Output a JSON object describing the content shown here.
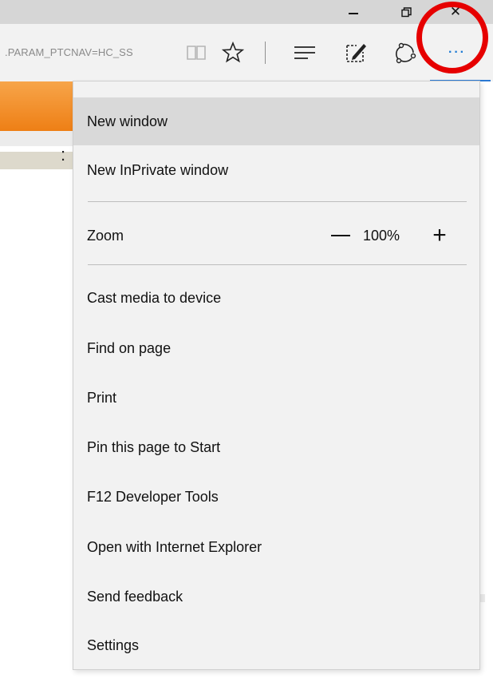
{
  "window": {
    "minimize_icon": "minimize-icon",
    "restore_icon": "restore-icon",
    "close_glyph": "✕"
  },
  "toolbar": {
    "address_text": ".PARAM_PTCNAV=HC_SS",
    "icons": [
      "reading-view-icon",
      "favorite-star-icon",
      "hub-icon",
      "web-note-icon",
      "share-icon",
      "more-actions-icon"
    ],
    "more_glyph": "···",
    "accent_color": "#2b79d3",
    "annotation_color": "#e60000"
  },
  "page": {
    "colon_text": ":"
  },
  "menu": {
    "items": [
      {
        "label": "New window",
        "selected": true
      },
      {
        "label": "New InPrivate window"
      },
      {
        "label": "Cast media to device"
      },
      {
        "label": "Find on page"
      },
      {
        "label": "Print"
      },
      {
        "label": "Pin this page to Start"
      },
      {
        "label": "F12 Developer Tools"
      },
      {
        "label": "Open with Internet Explorer"
      },
      {
        "label": "Send feedback"
      },
      {
        "label": "Settings"
      }
    ],
    "zoom": {
      "label": "Zoom",
      "value": "100%",
      "minus_icon": "zoom-out-icon",
      "plus_icon": "zoom-in-icon",
      "plus_glyph": "+"
    }
  }
}
